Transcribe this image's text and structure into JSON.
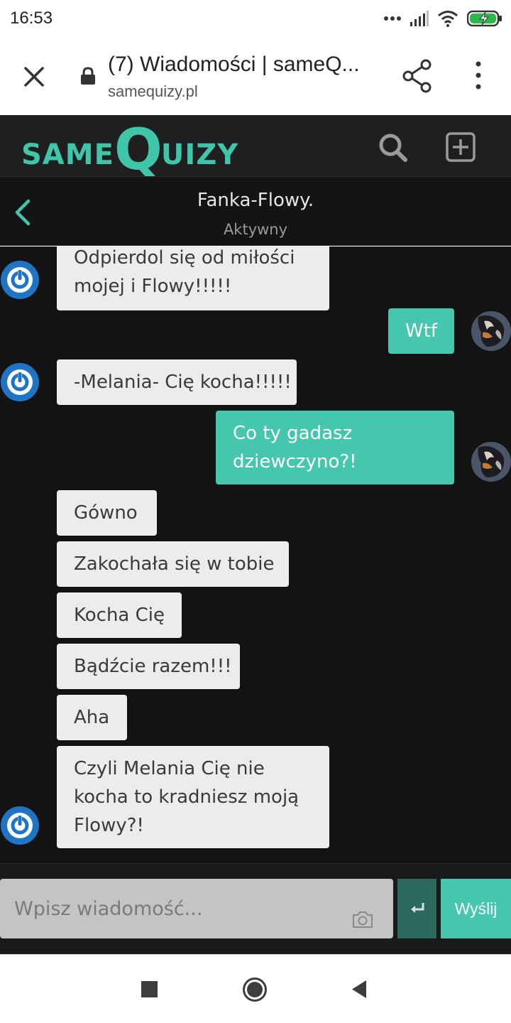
{
  "status_bar": {
    "time": "16:53",
    "icons": [
      "dots-icon",
      "signal-icon",
      "wifi-icon",
      "battery-charging-icon"
    ]
  },
  "browser": {
    "title": "(7) Wiadomości | sameQ...",
    "url": "samequizy.pl"
  },
  "site": {
    "logo_same": "SAME",
    "logo_q": "Q",
    "logo_uizy": "UIZY",
    "brand_color": "#3fc5a9"
  },
  "conversation": {
    "name": "Fanka-Flowy.",
    "status": "Aktywny"
  },
  "messages": [
    {
      "side": "in",
      "lines": [
        "Odpierdol się od miłości",
        "mojej i Flowy!!!!!"
      ]
    },
    {
      "side": "out",
      "lines": [
        "Wtf"
      ]
    },
    {
      "side": "in",
      "lines": [
        "-Melania- Cię kocha!!!!!"
      ]
    },
    {
      "side": "out",
      "lines": [
        "Co ty gadasz",
        "dziewczyno?!"
      ]
    },
    {
      "side": "in",
      "lines": [
        "Gówno"
      ]
    },
    {
      "side": "in",
      "lines": [
        "Zakochała się w tobie"
      ]
    },
    {
      "side": "in",
      "lines": [
        "Kocha Cię"
      ]
    },
    {
      "side": "in",
      "lines": [
        "Bądźcie razem!!!"
      ]
    },
    {
      "side": "in",
      "lines": [
        "Aha"
      ]
    },
    {
      "side": "in",
      "lines": [
        "Czyli Melania Cię nie",
        "kocha to kradniesz moją",
        "Flowy?!"
      ]
    }
  ],
  "composer": {
    "placeholder": "Wpisz wiadomość...",
    "send_label": "Wyślij"
  },
  "colors": {
    "incoming_bubble": "#ececec",
    "outgoing_bubble": "#45c7ae",
    "chat_background": "#131313",
    "avatar_blue": "#1f74c4"
  }
}
